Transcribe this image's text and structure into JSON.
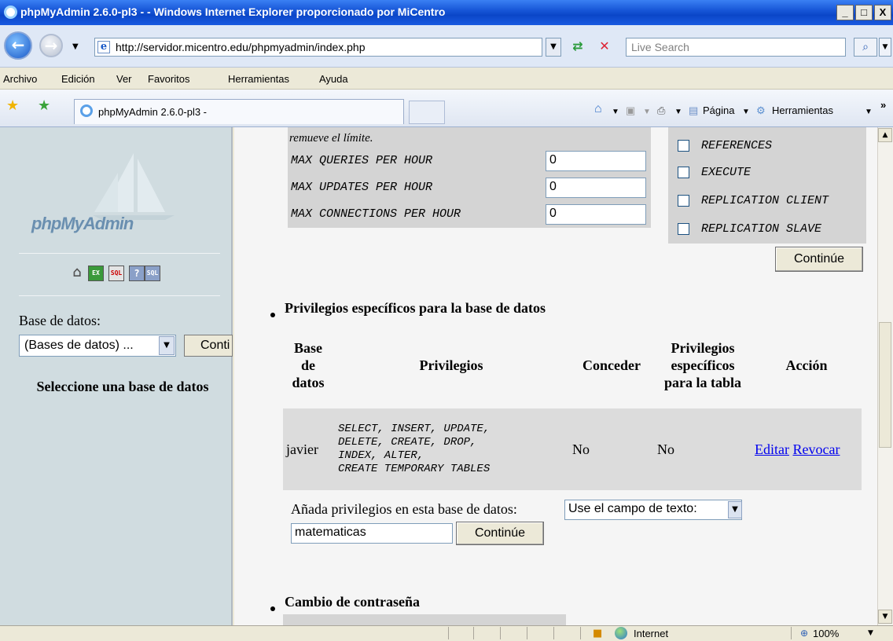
{
  "window": {
    "title": "phpMyAdmin 2.6.0-pl3 - - Windows Internet Explorer proporcionado por MiCentro",
    "controls": [
      "_",
      "□",
      "X"
    ]
  },
  "browser": {
    "address": "http://servidor.micentro.edu/phpmyadmin/index.php",
    "search_placeholder": "Live Search",
    "menu": [
      "Archivo",
      "Edición",
      "Ver",
      "Favoritos",
      "Herramientas",
      "Ayuda"
    ],
    "tab_title": "phpMyAdmin 2.6.0-pl3 -",
    "commands": [
      "Página",
      "Herramientas"
    ],
    "chevron": "»",
    "status_zone": "Internet",
    "zoom": "100%"
  },
  "left": {
    "logo": "phpMyAdmin",
    "db_label": "Base de datos:",
    "db_select_value": "(Bases de datos) ...",
    "go_button": "Conti",
    "message": "Seleccione una base de datos"
  },
  "main": {
    "limits_note": "remueve el límite.",
    "limits": [
      {
        "label": "MAX QUERIES PER HOUR",
        "value": "0"
      },
      {
        "label": "MAX UPDATES PER HOUR",
        "value": "0"
      },
      {
        "label": "MAX CONNECTIONS PER HOUR",
        "value": "0"
      }
    ],
    "admin_privs": [
      "REFERENCES",
      "EXECUTE",
      "REPLICATION CLIENT",
      "REPLICATION SLAVE"
    ],
    "continue_button": "Continúe",
    "section_db_title": "Privilegios específicos para la base de datos",
    "table_headers": {
      "db": "Base de datos",
      "privs": "Privilegios",
      "grant": "Conceder",
      "table_privs": "Privilegios específicos para la tabla",
      "action": "Acción"
    },
    "rows": [
      {
        "db": "javier",
        "privs": [
          "SELECT, INSERT, UPDATE,",
          "DELETE, CREATE, DROP,",
          "INDEX, ALTER,",
          "CREATE TEMPORARY TABLES"
        ],
        "grant": "No",
        "table_privs": "No",
        "edit": "Editar",
        "revoke": "Revocar"
      }
    ],
    "add_label": "Añada privilegios en esta base de datos:",
    "add_select": "Use el campo de texto:",
    "add_input": "matematicas",
    "add_button": "Continúe",
    "section_pw_title": "Cambio de contraseña"
  }
}
